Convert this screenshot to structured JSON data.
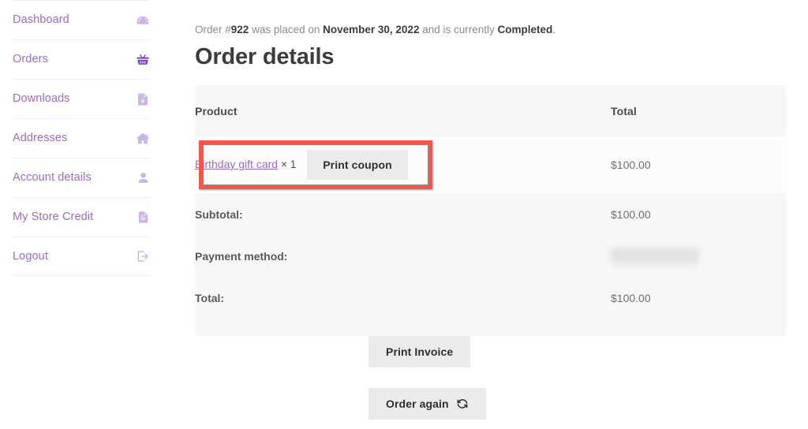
{
  "sidebar": {
    "items": [
      {
        "label": "Dashboard",
        "icon": "dashboard-gauge-icon",
        "name": "sidebar-item-dashboard"
      },
      {
        "label": "Orders",
        "icon": "shopping-basket-icon",
        "name": "sidebar-item-orders"
      },
      {
        "label": "Downloads",
        "icon": "file-download-icon",
        "name": "sidebar-item-downloads"
      },
      {
        "label": "Addresses",
        "icon": "home-icon",
        "name": "sidebar-item-addresses"
      },
      {
        "label": "Account details",
        "icon": "user-icon",
        "name": "sidebar-item-account-details"
      },
      {
        "label": "My Store Credit",
        "icon": "document-icon",
        "name": "sidebar-item-my-store-credit"
      },
      {
        "label": "Logout",
        "icon": "logout-icon",
        "name": "sidebar-item-logout"
      }
    ]
  },
  "main": {
    "status_line": {
      "prefix": "Order #",
      "order_number": "922",
      "middle": " was placed on ",
      "order_date": "November 30, 2022",
      "connector": " and is currently ",
      "status": "Completed",
      "suffix": "."
    },
    "page_title": "Order details",
    "table": {
      "headers": {
        "product": "Product",
        "total": "Total"
      },
      "product_row": {
        "product_name": "Birthday gift card",
        "quantity": "× 1",
        "coupon_button_label": "Print coupon",
        "total": "$100.00"
      },
      "totals": [
        {
          "label": "Subtotal:",
          "value": "$100.00",
          "redacted": false
        },
        {
          "label": "Payment method:",
          "value": "",
          "redacted": true
        },
        {
          "label": "Total:",
          "value": "$100.00",
          "redacted": false
        }
      ]
    },
    "actions": {
      "print_invoice_label": "Print Invoice",
      "order_again_label": "Order again",
      "order_again_icon": "refresh-sync-icon"
    }
  },
  "colors": {
    "link_purple": "#9b6bc9",
    "icon_purple_light": "#cbb5e4",
    "icon_purple_strong": "#7b3fb8",
    "highlight_red": "#f8564a",
    "table_header_bg": "#f7f7f7",
    "product_row_bg": "#fdfcfc",
    "button_bg": "#ebebeb",
    "text_dark": "#3c3c3c",
    "text_muted": "#8b8b8b"
  }
}
